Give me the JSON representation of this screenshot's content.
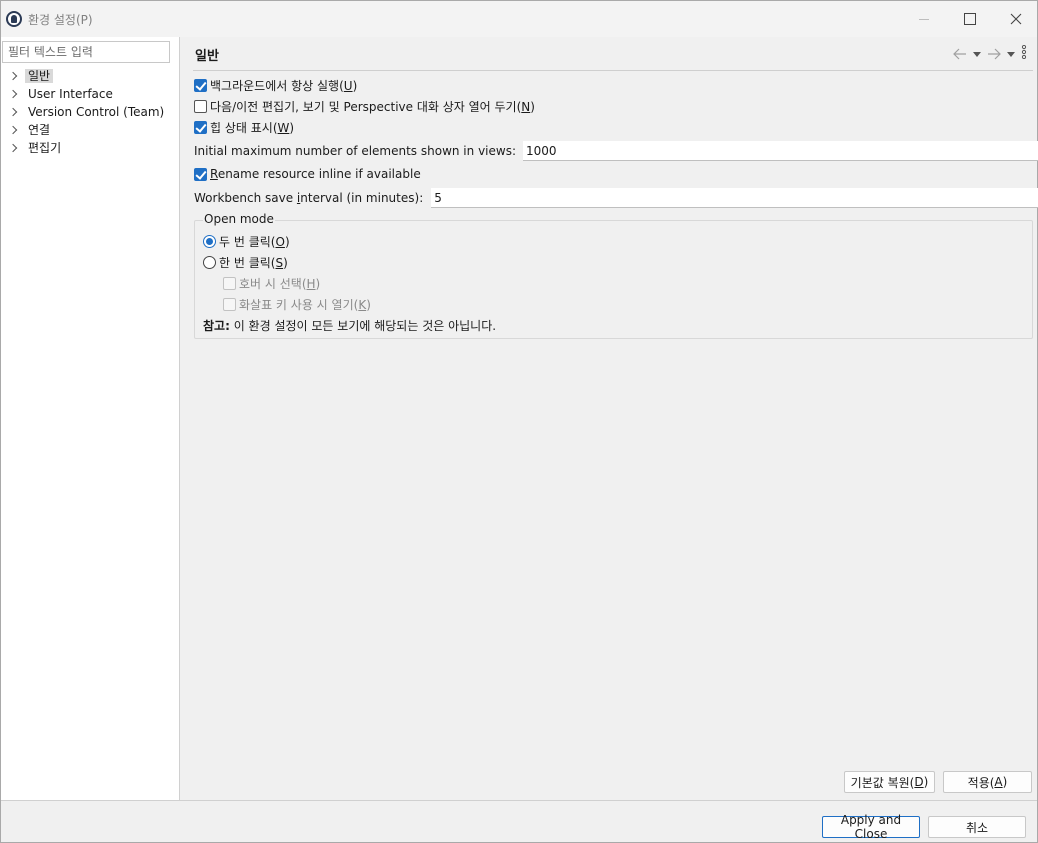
{
  "window": {
    "title": "환경 설정(P)"
  },
  "filter": {
    "placeholder": "필터 텍스트 입력"
  },
  "tree": {
    "items": [
      {
        "label": "일반",
        "selected": true
      },
      {
        "label": "User Interface"
      },
      {
        "label": "Version Control (Team)"
      },
      {
        "label": "연결"
      },
      {
        "label": "편집기"
      }
    ]
  },
  "page": {
    "title": "일반"
  },
  "options": {
    "run_in_background": {
      "text": "백그라운드에서 항상 실행(",
      "mnemonic": "U",
      "suffix": ")",
      "checked": true
    },
    "keep_next_prev": {
      "text": "다음/이전 편집기, 보기 및 Perspective 대화 상자 열어 두기(",
      "mnemonic": "N",
      "suffix": ")",
      "checked": false
    },
    "show_heap": {
      "text": "힙 상태 표시(",
      "mnemonic": "W",
      "suffix": ")",
      "checked": true
    },
    "initial_max_label": "Initial maximum number of elements shown in views:",
    "initial_max_value": "1000",
    "rename_inline": {
      "mnemonic": "R",
      "text": "ename resource inline if available",
      "checked": true
    },
    "save_interval_label_pre": "Workbench save ",
    "save_interval_mnemonic": "i",
    "save_interval_label_post": "nterval (in minutes):",
    "save_interval_value": "5"
  },
  "open_mode": {
    "title": "Open mode",
    "double_click": {
      "text": "두 번 클릭(",
      "mnemonic": "O",
      "suffix": ")",
      "selected": true
    },
    "single_click": {
      "text": "한 번 클릭(",
      "mnemonic": "S",
      "suffix": ")",
      "selected": false
    },
    "select_on_hover": {
      "text": "호버 시 선택(",
      "mnemonic": "H",
      "suffix": ")",
      "checked": false
    },
    "open_arrow_keys": {
      "text": "화살표 키 사용 시 열기(",
      "mnemonic": "K",
      "suffix": ")",
      "checked": false
    },
    "note_bold": "참고:",
    "note_text": " 이 환경 설정이 모든 보기에 해당되는 것은 아닙니다."
  },
  "buttons": {
    "restore_defaults": {
      "text": "기본값 복원(",
      "mnemonic": "D",
      "suffix": ")"
    },
    "apply": {
      "text": "적용(",
      "mnemonic": "A",
      "suffix": ")"
    },
    "apply_close": "Apply and Close",
    "cancel": "취소"
  },
  "colors": {
    "accent": "#1f6fc5",
    "selection": "#d9d9d9"
  }
}
